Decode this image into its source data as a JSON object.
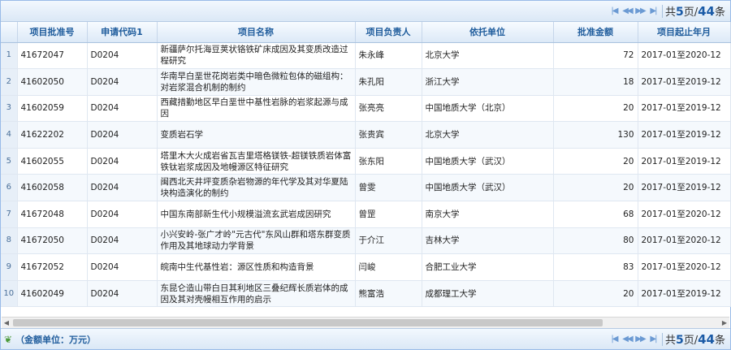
{
  "pager": {
    "first_icon": "first-page-icon",
    "prev_icon": "prev-page-icon",
    "next_icon": "next-page-icon",
    "last_icon": "last-page-icon",
    "text_pre": "共",
    "pages": "5",
    "text_mid": "页/",
    "total": "44",
    "text_post": "条"
  },
  "columns": [
    "项目批准号",
    "申请代码1",
    "项目名称",
    "项目负责人",
    "依托单位",
    "批准金额",
    "项目起止年月"
  ],
  "rows": [
    {
      "idx": "1",
      "id": "41672047",
      "code": "D0204",
      "name": "新疆萨尔托海豆荚状铬铁矿床成因及其变质改造过程研究",
      "leader": "朱永峰",
      "unit": "北京大学",
      "amount": "72",
      "period": "2017-01至2020-12"
    },
    {
      "idx": "2",
      "id": "41602050",
      "code": "D0204",
      "name": "华南早白垩世花岗岩类中暗色微粒包体的磁组构：对岩浆混合机制的制约",
      "leader": "朱孔阳",
      "unit": "浙江大学",
      "amount": "18",
      "period": "2017-01至2019-12"
    },
    {
      "idx": "3",
      "id": "41602059",
      "code": "D0204",
      "name": "西藏措勤地区早白垩世中基性岩脉的岩浆起源与成因",
      "leader": "张亮亮",
      "unit": "中国地质大学（北京）",
      "amount": "20",
      "period": "2017-01至2019-12"
    },
    {
      "idx": "4",
      "id": "41622202",
      "code": "D0204",
      "name": "变质岩石学",
      "leader": "张贵宾",
      "unit": "北京大学",
      "amount": "130",
      "period": "2017-01至2019-12"
    },
    {
      "idx": "5",
      "id": "41602055",
      "code": "D0204",
      "name": "塔里木大火成岩省瓦吉里塔格镁铁-超镁铁质岩体富铁钛岩浆成因及地幔源区特征研究",
      "leader": "张东阳",
      "unit": "中国地质大学（武汉）",
      "amount": "20",
      "period": "2017-01至2019-12"
    },
    {
      "idx": "6",
      "id": "41602058",
      "code": "D0204",
      "name": "闽西北天井坪变质杂岩物源的年代学及其对华夏陆块构造演化的制约",
      "leader": "曾雯",
      "unit": "中国地质大学（武汉）",
      "amount": "20",
      "period": "2017-01至2019-12"
    },
    {
      "idx": "7",
      "id": "41672048",
      "code": "D0204",
      "name": "中国东南部新生代小规模溢流玄武岩成因研究",
      "leader": "曾罡",
      "unit": "南京大学",
      "amount": "68",
      "period": "2017-01至2020-12"
    },
    {
      "idx": "8",
      "id": "41672050",
      "code": "D0204",
      "name": "小兴安岭-张广才岭\"元古代\"东风山群和塔东群变质作用及其地球动力学背景",
      "leader": "于介江",
      "unit": "吉林大学",
      "amount": "80",
      "period": "2017-01至2020-12"
    },
    {
      "idx": "9",
      "id": "41672052",
      "code": "D0204",
      "name": "皖南中生代基性岩：源区性质和构造背景",
      "leader": "闫峻",
      "unit": "合肥工业大学",
      "amount": "83",
      "period": "2017-01至2020-12"
    },
    {
      "idx": "10",
      "id": "41602049",
      "code": "D0204",
      "name": "东昆仑造山带白日其利地区三叠纪辉长质岩体的成因及其对壳幔相互作用的启示",
      "leader": "熊富浩",
      "unit": "成都理工大学",
      "amount": "20",
      "period": "2017-01至2019-12"
    }
  ],
  "footer": {
    "leaf_icon": "leaf-icon",
    "note": "（金额单位：万元）"
  }
}
